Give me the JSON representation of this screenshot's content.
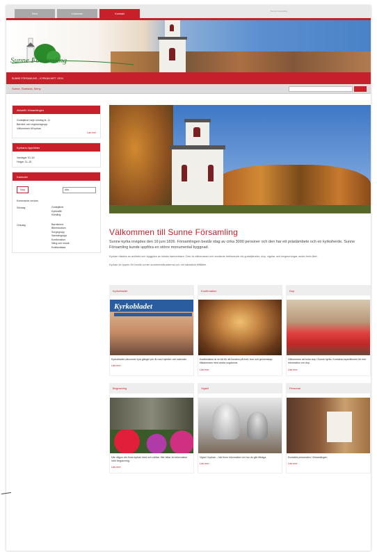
{
  "top_tabs": [
    {
      "label": "Hem"
    },
    {
      "label": "Kalender"
    },
    {
      "label": "Kontakt"
    }
  ],
  "top_link": "Sunne Församling",
  "logo": {
    "text": "Sunne Församling"
  },
  "red_bar": "SUNNE FÖRSAMLING – KYRKAN MITT I BYN",
  "breadcrumb": "Sunne, Startsida, Meny",
  "search": {
    "placeholder": "",
    "button": ""
  },
  "left": {
    "box1": {
      "title": "Aktuellt i församlingen",
      "lines": [
        "Gudstjänst varje söndag kl. 11",
        "Barnkör och ungdomsgrupp",
        "Välkommen till kyrkan"
      ],
      "more": "Läs mer"
    },
    "box2": {
      "title": "Kyrkans öppettider",
      "lines": [
        "Vardagar 10–16",
        "Helger 11–15"
      ]
    },
    "box3": {
      "title": "Kalender",
      "today_btn": "Idag",
      "select": "Alla",
      "headline": "Kommande veckan",
      "events": [
        {
          "day": "Söndag",
          "items": [
            "Gudstjänst",
            "Kyrkkaffe",
            "Körsång"
          ]
        },
        {
          "day": "Onsdag",
          "items": [
            "Barntimme",
            "Bibelstudium",
            "Sorgegrupp",
            "Samtalsgrupp",
            "Konfirmation",
            "Sång och musik",
            "Kvällsmässa"
          ]
        }
      ]
    }
  },
  "welcome": {
    "title": "Välkommen till Sunne Församling",
    "lead": "Sunne kyrka invigdes den 16 juni 1826. Församlingen består idag av cirka 3000 personer och den har ett prästämbete och en kyrkoherde. Sunne Församling kunde uppföra en större monumental byggnad.",
    "body1": "Kyrkan ritades av arkitekt och byggdes av lokala hantverkare. Den är välbevarad och används fortfarande vid gudstjänster, dop, vigslar och begravningar under hela året.",
    "body2": "Kyrkan är öppen för besök under sommarmånaderna och vid särskilda tillfällen."
  },
  "cards": [
    {
      "title": "Kyrkobladet",
      "masthead": "Kyrkobladet",
      "text": "Kyrkobladet utkommer fyra gånger per år med nyheter och kalender.",
      "more": "Läs mer"
    },
    {
      "title": "Konfirmation",
      "text": "Konfirmation är en tid för att fundera på livet, tron och gemenskap tillsammans med andra ungdomar.",
      "more": "Läs mer"
    },
    {
      "title": "Dop",
      "text": "Välkommen att boka dop i Sunne kyrka. Kontakta expeditionen för mer information om dop.",
      "more": "Läs mer"
    },
    {
      "title": "Begravning",
      "text": "När någon dör finns kyrkan med och stöttar. Här hittar du information inför begravning.",
      "more": "Läs mer"
    },
    {
      "title": "Vigsel",
      "text": "Vigsel i kyrkan – här finns information om hur du går tillväga.",
      "more": "Läs mer"
    },
    {
      "title": "Personal",
      "text": "Kontakta personalen i församlingen.",
      "more": "Läs mer"
    }
  ],
  "colors": {
    "brand_red": "#c8202b",
    "sky_blue": "#4a82c7"
  }
}
